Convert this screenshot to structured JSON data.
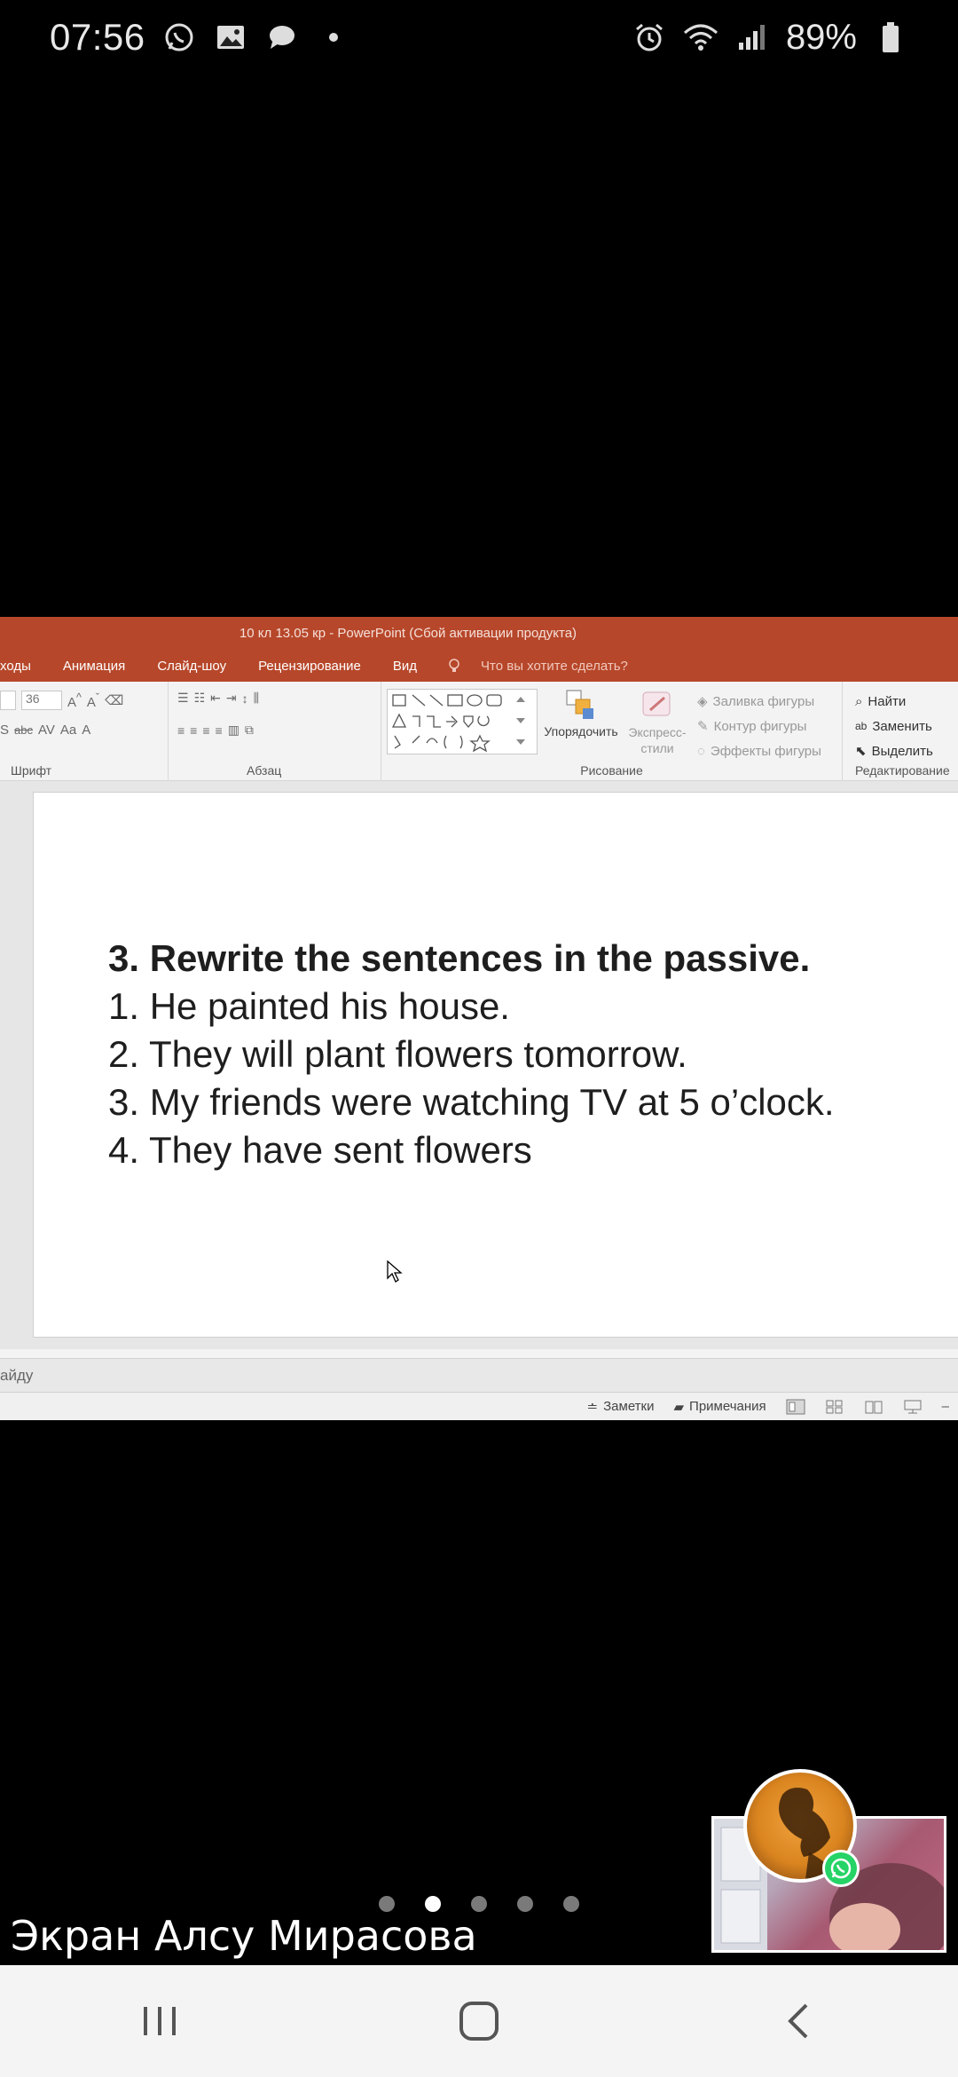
{
  "status_bar": {
    "time": "07:56",
    "left_icons": [
      "whatsapp-icon",
      "image-icon",
      "chat-bubble-icon",
      "dot-icon"
    ],
    "right_icons": [
      "alarm-icon",
      "wifi-icon",
      "signal-icon"
    ],
    "battery": "89%"
  },
  "powerpoint": {
    "window_title": "10 кл 13.05 кр - PowerPoint (Сбой активации продукта)",
    "tabs": [
      "ходы",
      "Анимация",
      "Слайд-шоу",
      "Рецензирование",
      "Вид"
    ],
    "tell_me": "Что вы хотите сделать?",
    "ribbon": {
      "font_size": "36",
      "groups": {
        "font": "Шрифт",
        "paragraph": "Абзац",
        "drawing": "Рисование",
        "editing": "Редактирование"
      },
      "arrange_label": "Упорядочить",
      "quick_styles_label": "Экспресс-\nстили",
      "shape_fill": "Заливка фигуры",
      "shape_outline": "Контур фигуры",
      "shape_effects": "Эффекты фигуры",
      "find": "Найти",
      "replace": "Заменить",
      "select": "Выделить"
    },
    "slide": {
      "heading": "3. Rewrite the sentences in the passive.",
      "lines": [
        "1. He painted his house.",
        "2. They will plant flowers tomorrow.",
        "3. My friends were watching TV at 5 o’clock.",
        "4. They have sent flowers"
      ]
    },
    "notes_hint": "айду",
    "status_bar": {
      "notes": "Заметки",
      "comments": "Примечания"
    }
  },
  "call": {
    "screen_owner_label": "Экран Алсу Мирасова",
    "page_count": 5,
    "active_page": 2
  },
  "colors": {
    "ribbon_accent": "#b7472a",
    "whatsapp_green": "#25d366"
  }
}
